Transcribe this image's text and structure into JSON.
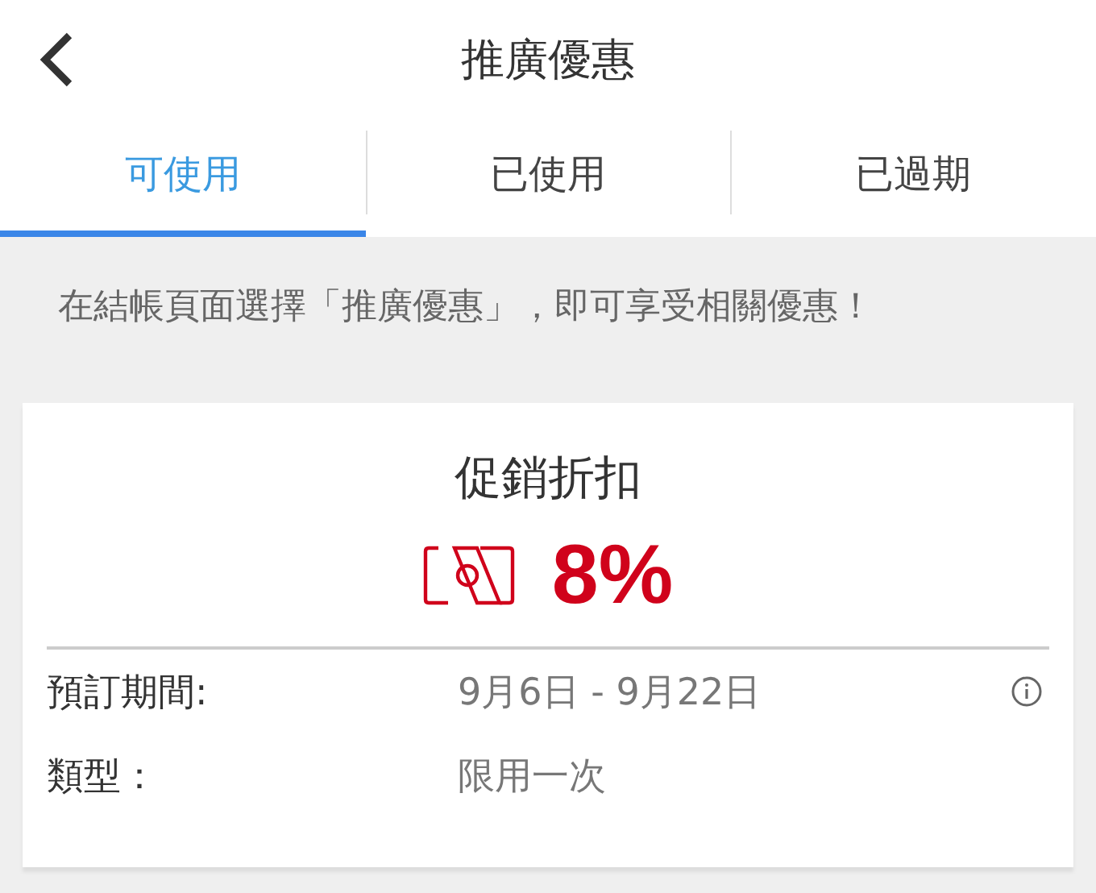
{
  "header": {
    "title": "推廣優惠"
  },
  "tabs": [
    {
      "label": "可使用",
      "selected": true
    },
    {
      "label": "已使用",
      "selected": false
    },
    {
      "label": "已過期",
      "selected": false
    }
  ],
  "notice": "在結帳頁面選擇「推廣優惠」，即可享受相關優惠！",
  "coupon": {
    "title": "促銷折扣",
    "discount": "8%",
    "details": [
      {
        "label": "預訂期間:",
        "value": "9月6日 - 9月22日",
        "info": true
      },
      {
        "label": "類型：",
        "value": "限用一次",
        "info": false
      }
    ]
  }
}
